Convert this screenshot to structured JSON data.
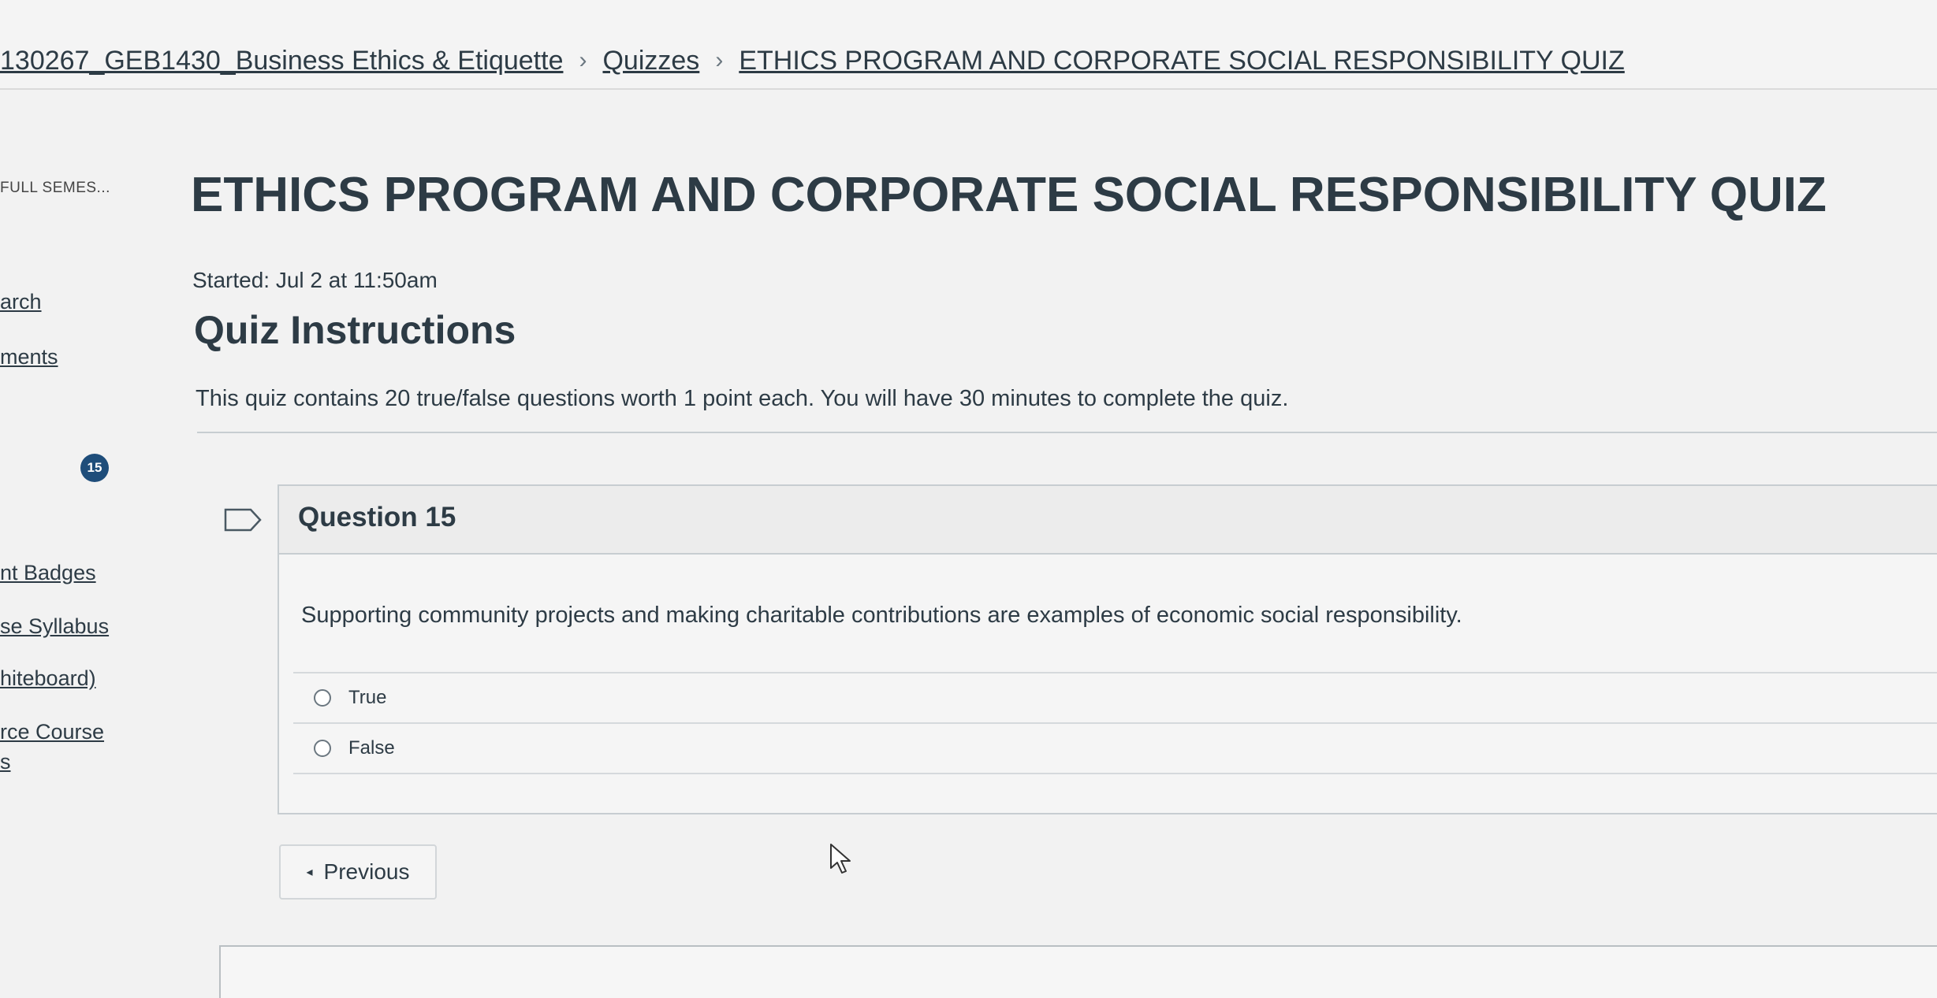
{
  "breadcrumb": {
    "course": "130267_GEB1430_Business Ethics & Etiquette",
    "section": "Quizzes",
    "current": "ETHICS PROGRAM AND CORPORATE SOCIAL RESPONSIBILITY QUIZ",
    "separator": "›"
  },
  "sidebar": {
    "term": "FULL SEMES...",
    "items": [
      {
        "label": "arch"
      },
      {
        "label": "ments"
      },
      {
        "label": "nt Badges"
      },
      {
        "label": "se Syllabus"
      },
      {
        "label": "hiteboard)"
      },
      {
        "label": "rce Course"
      },
      {
        "label": "s"
      }
    ],
    "badge_count": "15"
  },
  "quiz": {
    "title": "ETHICS PROGRAM AND CORPORATE SOCIAL RESPONSIBILITY QUIZ",
    "started": "Started: Jul 2 at 11:50am",
    "instructions_heading": "Quiz Instructions",
    "instructions_text": "This quiz contains 20 true/false questions worth 1 point each. You will have 30 minutes to complete the quiz."
  },
  "question": {
    "title": "Question 15",
    "text": "Supporting community projects and making charitable contributions are examples of economic social responsibility.",
    "answers": [
      {
        "label": "True",
        "selected": false
      },
      {
        "label": "False",
        "selected": false
      }
    ]
  },
  "navigation": {
    "previous_label": "Previous",
    "previous_arrow": "◂"
  },
  "colors": {
    "text": "#2d3b45",
    "badge": "#1e4d7a",
    "border": "#c7cdd1",
    "background": "#f2f2f2"
  },
  "icons": [
    "flag-icon",
    "radio-icon",
    "mouse-cursor-icon"
  ]
}
